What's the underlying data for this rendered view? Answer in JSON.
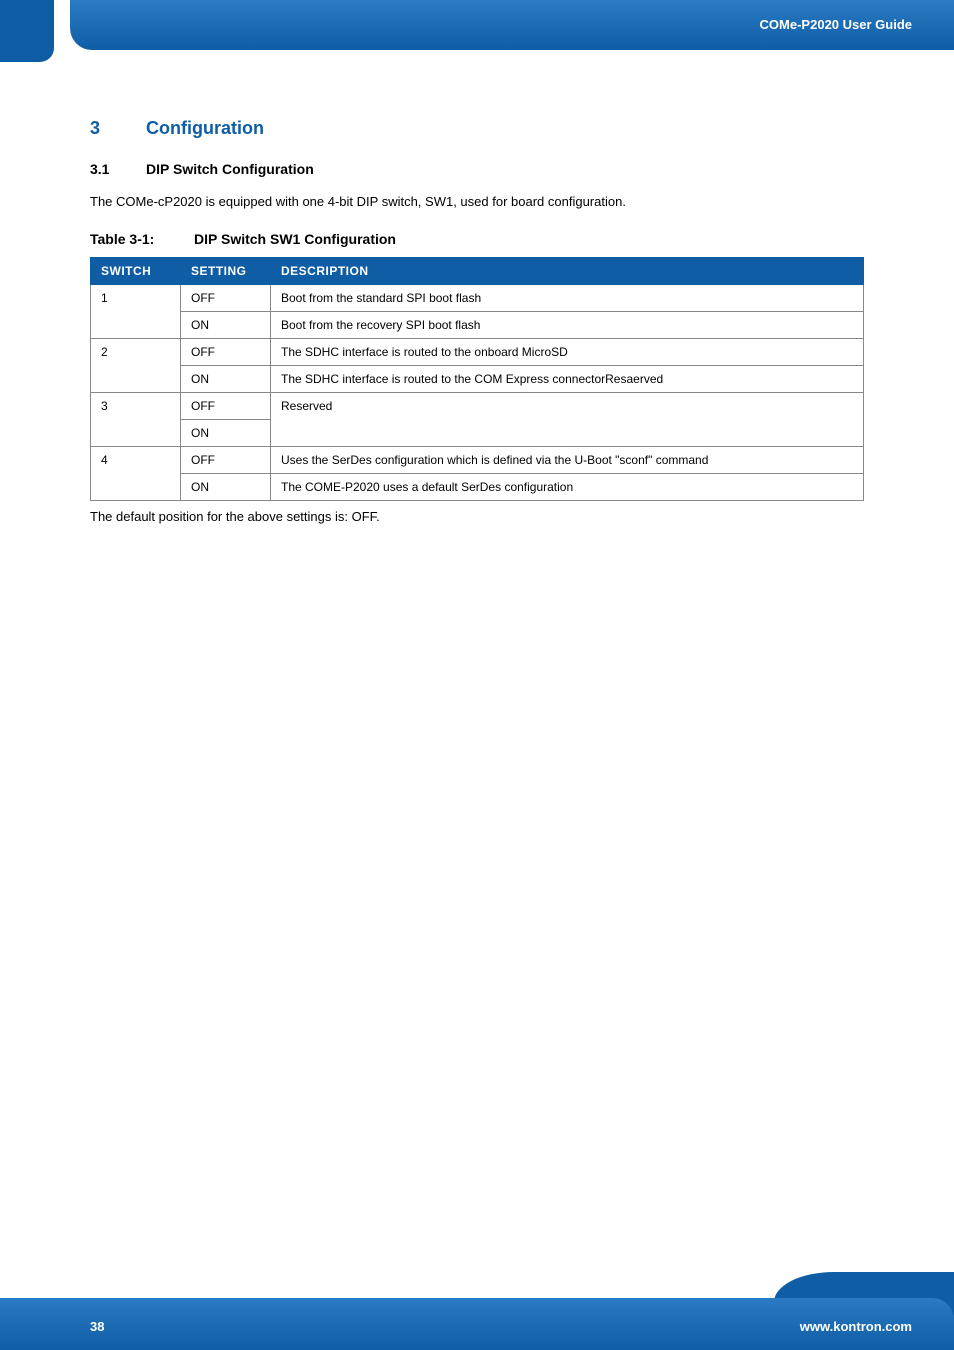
{
  "header": {
    "title": "COMe-P2020 User Guide"
  },
  "section": {
    "number": "3",
    "title": "Configuration",
    "sub": {
      "number": "3.1",
      "title": "DIP Switch Configuration"
    }
  },
  "intro_para": "The COMe-cP2020 is equipped with one 4-bit DIP switch, SW1, used for board configuration.",
  "table_caption": {
    "label": "Table 3-1:",
    "title": "DIP Switch SW1 Configuration"
  },
  "table": {
    "headers": {
      "switch": "SWITCH",
      "setting": "SETTING",
      "description": "DESCRIPTION"
    },
    "rows": [
      {
        "switch": "1",
        "setting": "OFF",
        "description": "Boot from the standard SPI boot flash"
      },
      {
        "switch": "",
        "setting": "ON",
        "description": "Boot from the recovery SPI boot flash"
      },
      {
        "switch": "2",
        "setting": "OFF",
        "description": "The SDHC interface is routed to the onboard MicroSD"
      },
      {
        "switch": "",
        "setting": "ON",
        "description": "The SDHC interface is routed to the COM Express connectorResaerved"
      },
      {
        "switch": "3",
        "setting": "OFF",
        "description": "Reserved"
      },
      {
        "switch": "",
        "setting": "ON",
        "description": ""
      },
      {
        "switch": "4",
        "setting": "OFF",
        "description": "Uses the SerDes configuration which is defined via the U-Boot \"sconf\" command"
      },
      {
        "switch": "",
        "setting": "ON",
        "description": "The COME-P2020 uses a default SerDes configuration"
      }
    ]
  },
  "after_table": "The default position for the above settings is: OFF.",
  "footer": {
    "page": "38",
    "url": "www.kontron.com"
  }
}
